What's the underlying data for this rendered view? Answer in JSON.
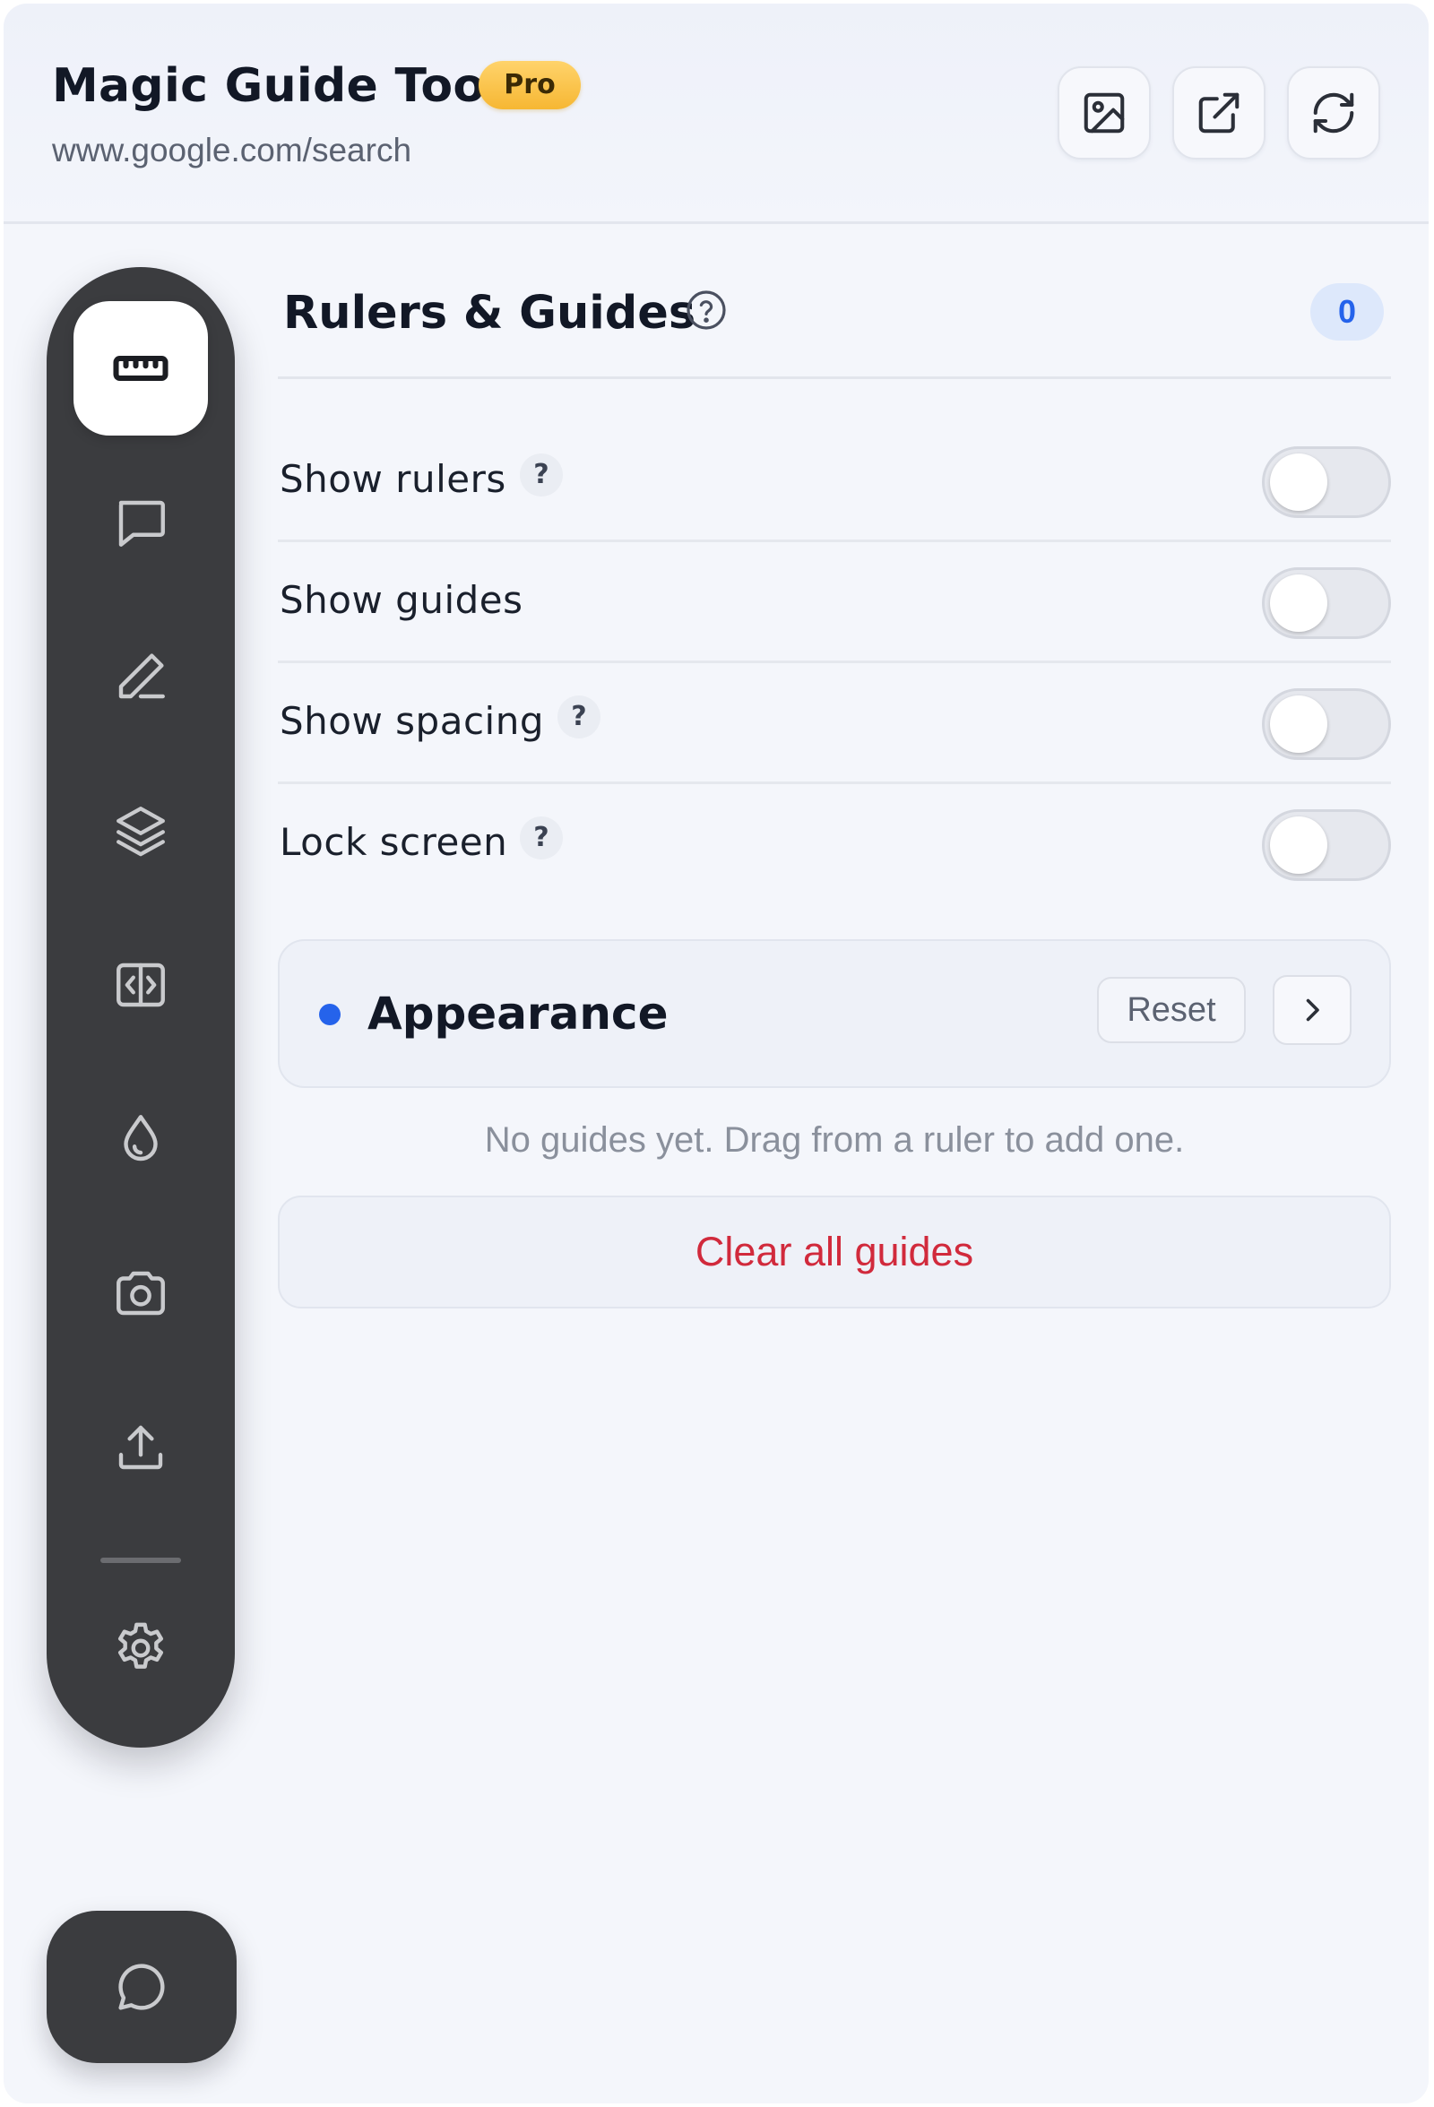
{
  "header": {
    "title": "Magic Guide Tool",
    "badge": "Pro",
    "url": "www.google.com/search",
    "buttons": [
      {
        "icon": "image-icon"
      },
      {
        "icon": "external-link-icon"
      },
      {
        "icon": "refresh-icon"
      }
    ]
  },
  "sidebar": {
    "items": [
      {
        "icon": "ruler-icon",
        "active": true
      },
      {
        "icon": "comment-icon",
        "active": false
      },
      {
        "icon": "pencil-icon",
        "active": false
      },
      {
        "icon": "layers-icon",
        "active": false
      },
      {
        "icon": "code-split-icon",
        "active": false
      },
      {
        "icon": "droplet-icon",
        "active": false
      },
      {
        "icon": "camera-icon",
        "active": false
      },
      {
        "icon": "upload-icon",
        "active": false
      },
      {
        "icon": "gear-icon",
        "active": false
      }
    ],
    "fab_icon": "chat-icon"
  },
  "section": {
    "title": "Rulers & Guides",
    "count": "0"
  },
  "settings": [
    {
      "label": "Show rulers",
      "help": "?",
      "enabled": false
    },
    {
      "label": "Show guides",
      "enabled": false
    },
    {
      "label": "Show spacing",
      "help": "?",
      "enabled": false
    },
    {
      "label": "Lock screen",
      "help": "?",
      "enabled": false
    }
  ],
  "appearance": {
    "title": "Appearance",
    "reset_label": "Reset"
  },
  "empty_note": "No guides yet. Drag from a ruler to add one.",
  "clear_label": "Clear all guides",
  "colors": {
    "accent": "#2563eb",
    "danger": "#d12a3c",
    "sidebar": "#3b3c3f",
    "pro_badge": "#f6b733"
  }
}
